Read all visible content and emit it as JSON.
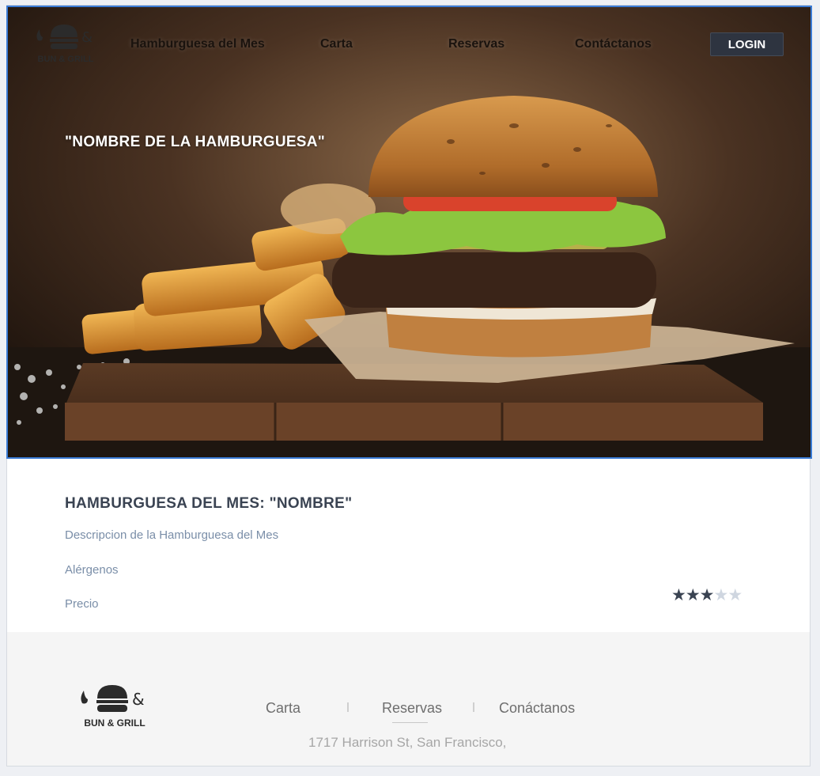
{
  "brand": {
    "logo_text": "BUN & GRILL",
    "logo_icon": "burger-logo-icon"
  },
  "nav": {
    "items": [
      {
        "label": "Hamburguesa del Mes"
      },
      {
        "label": "Carta"
      },
      {
        "label": "Reservas"
      },
      {
        "label": "Contáctanos"
      }
    ],
    "login_label": "LOGIN"
  },
  "hero": {
    "title": "\"NOMBRE DE LA HAMBURGUESA\"",
    "image": "burger-with-fries-photo"
  },
  "burger_of_month": {
    "heading": "HAMBURGUESA DEL MES: \"NOMBRE\"",
    "description": "Descripcion de la Hamburguesa del Mes",
    "allergens": "Alérgenos",
    "price": "Precio",
    "rating": 3,
    "rating_max": 5,
    "star_glyph": "★"
  },
  "footer": {
    "logo_text": "BUN & GRILL",
    "links": [
      {
        "label": "Carta"
      },
      {
        "label": "Reservas"
      },
      {
        "label": "Conáctanos"
      }
    ],
    "address": "1717 Harrison St, San Francisco,"
  },
  "colors": {
    "accent_border": "#3a7bd5",
    "login_bg": "#2e3440",
    "heading": "#3a4352",
    "muted_text": "#7a8ea8"
  }
}
